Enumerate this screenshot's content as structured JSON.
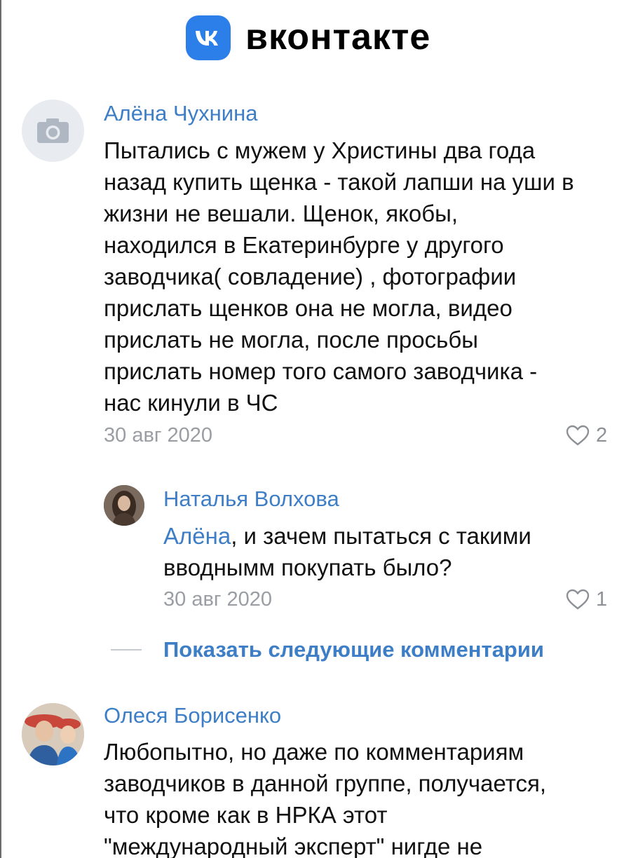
{
  "header": {
    "logo_icon": "vk-logo-icon",
    "brand_name": "вконтакте",
    "brand_color": "#2c7ee8"
  },
  "comments": [
    {
      "author": "Алёна Чухнина",
      "avatar_icon": "camera-icon",
      "text_lines": [
        "Пытались с мужем у Христины два года",
        "назад купить щенка - такой лапши на уши в",
        "жизни не вешали. Щенок, якобы,",
        "находился в Екатеринбурге у другого",
        "заводчика( совладение) , фотографии",
        "прислать щенков она не могла, видео",
        "прислать не могла, после просьбы",
        "прислать номер того самого заводчика -",
        "нас кинули в ЧС"
      ],
      "date": "30 авг 2020",
      "likes": "2"
    },
    {
      "author": "Наталья Волхова",
      "mention": "Алёна",
      "text_lines": [
        ", и зачем пытаться с такими",
        "вводнымм покупать было?"
      ],
      "date": "30 авг 2020",
      "likes": "1"
    },
    {
      "author": "Олеся Борисенко",
      "text_lines": [
        "Любопытно, но даже по комментариям",
        "заводчиков в данной группе, получается,",
        "что кроме как в НРКА этот",
        "\"международный эксперт\" нигде не"
      ]
    }
  ],
  "show_more_label": "Показать следующие комментарии",
  "colors": {
    "link": "#3d7ec7",
    "meta": "#9a9ea3",
    "text": "#111111"
  }
}
